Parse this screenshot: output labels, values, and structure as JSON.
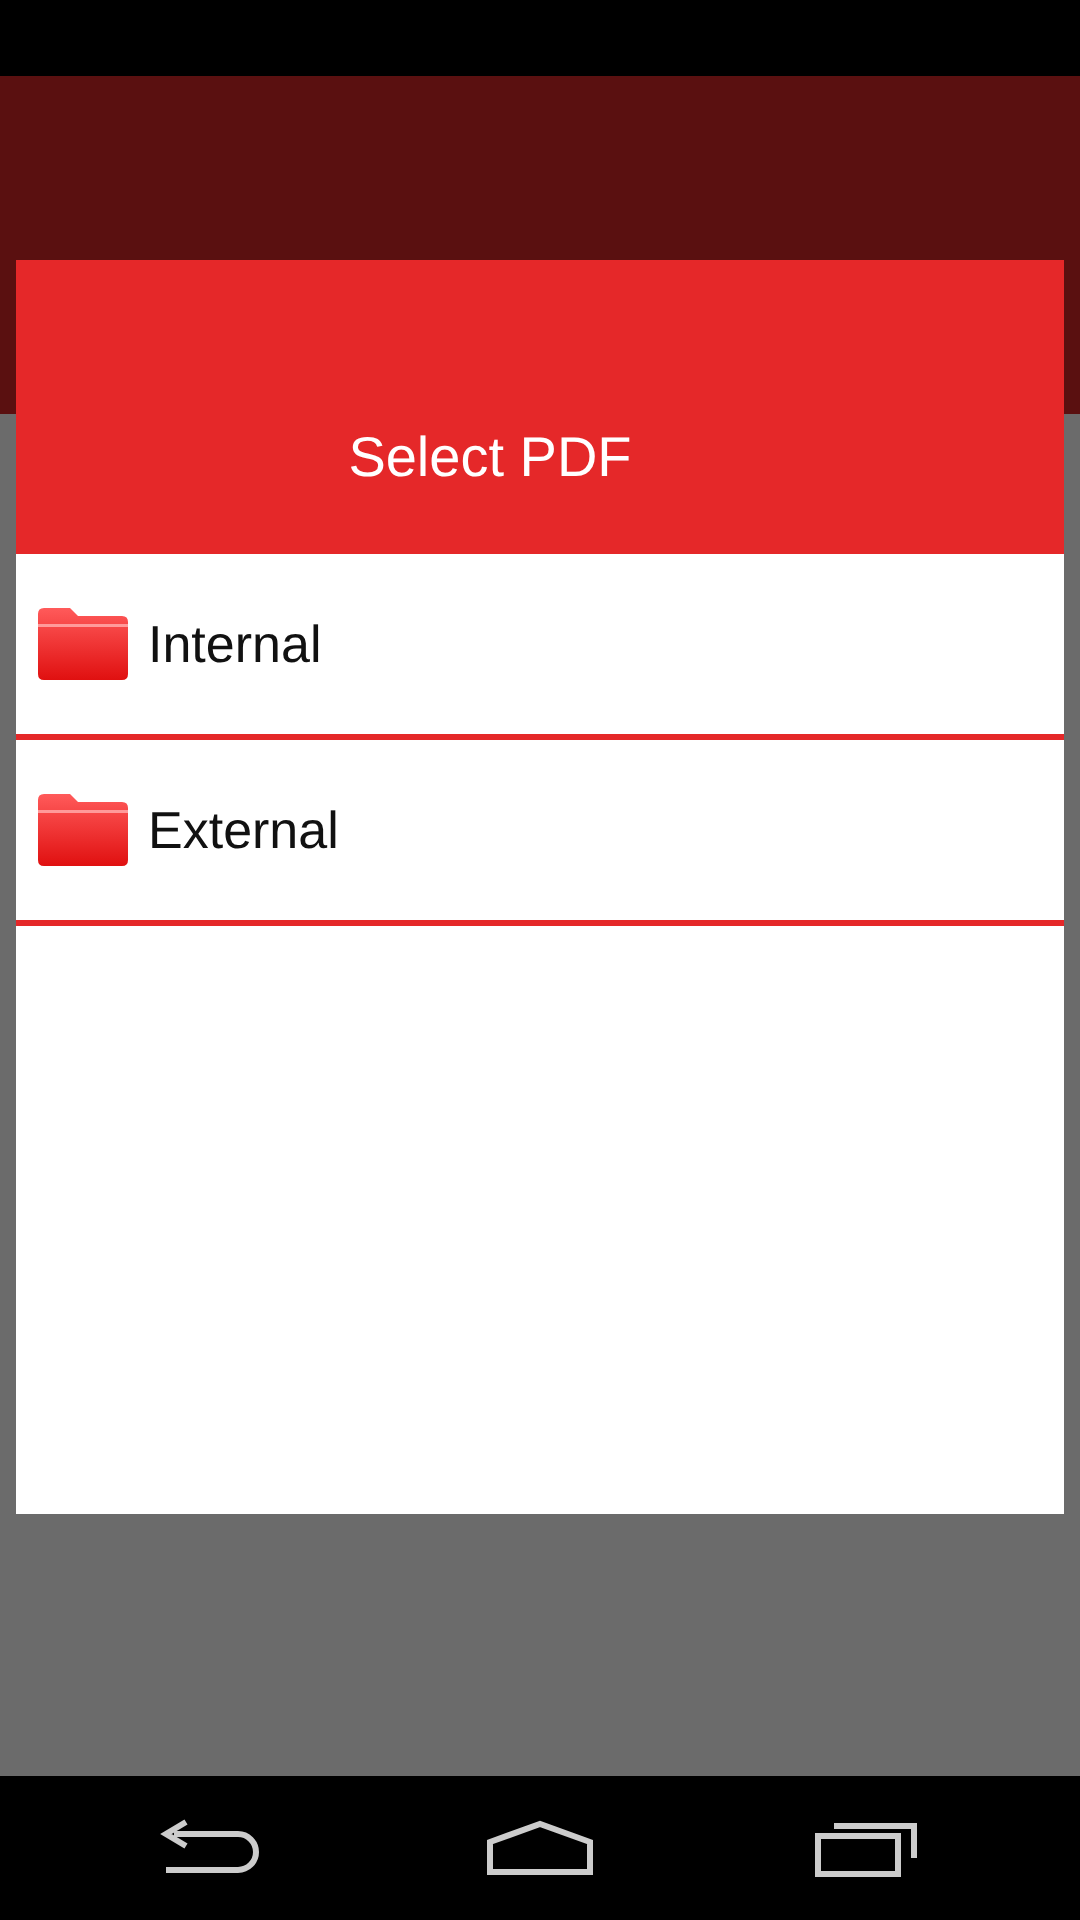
{
  "dialog": {
    "title": "Select PDF",
    "items": [
      {
        "label": "Internal"
      },
      {
        "label": "External"
      }
    ]
  }
}
